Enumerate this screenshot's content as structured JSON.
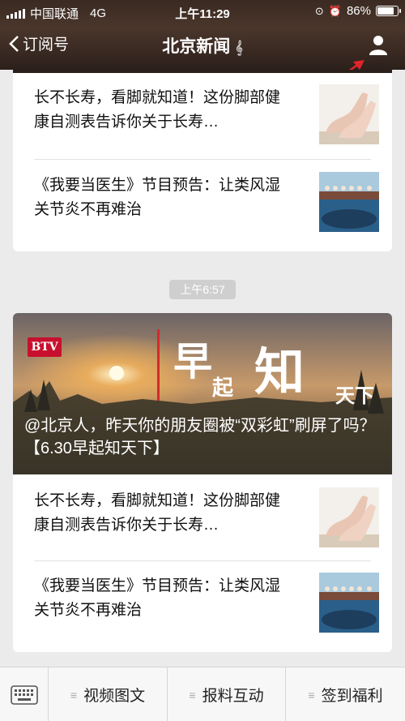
{
  "status_bar": {
    "carrier": "中国联通",
    "network": "4G",
    "time": "上午11:29",
    "battery": "86%",
    "battery_level": 0.86
  },
  "nav": {
    "back_label": "订阅号",
    "title": "北京新闻"
  },
  "top_card": {
    "items": [
      {
        "title": "长不长寿，看脚就知道！这份脚部健康自测表告诉你关于长寿…"
      },
      {
        "title": "《我要当医生》节目预告：让类风湿关节炎不再难治"
      }
    ]
  },
  "timestamp": "上午6:57",
  "main_card": {
    "banner": {
      "channel_logo": "BTV",
      "logo_text": [
        "早",
        "起",
        "知",
        "天下"
      ],
      "caption": "@北京人，昨天你的朋友圈被“双彩虹”刷屏了吗？【6.30早起知天下】"
    },
    "items": [
      {
        "title": "长不长寿，看脚就知道！这份脚部健康自测表告诉你关于长寿…"
      },
      {
        "title": "《我要当医生》节目预告：让类风湿关节炎不再难治"
      }
    ]
  },
  "bottom_menu": [
    {
      "label": "视频图文"
    },
    {
      "label": "报料互动"
    },
    {
      "label": "签到福利"
    }
  ],
  "colors": {
    "annotation_arrow": "#e0252a",
    "btv_red": "#c8102e"
  }
}
